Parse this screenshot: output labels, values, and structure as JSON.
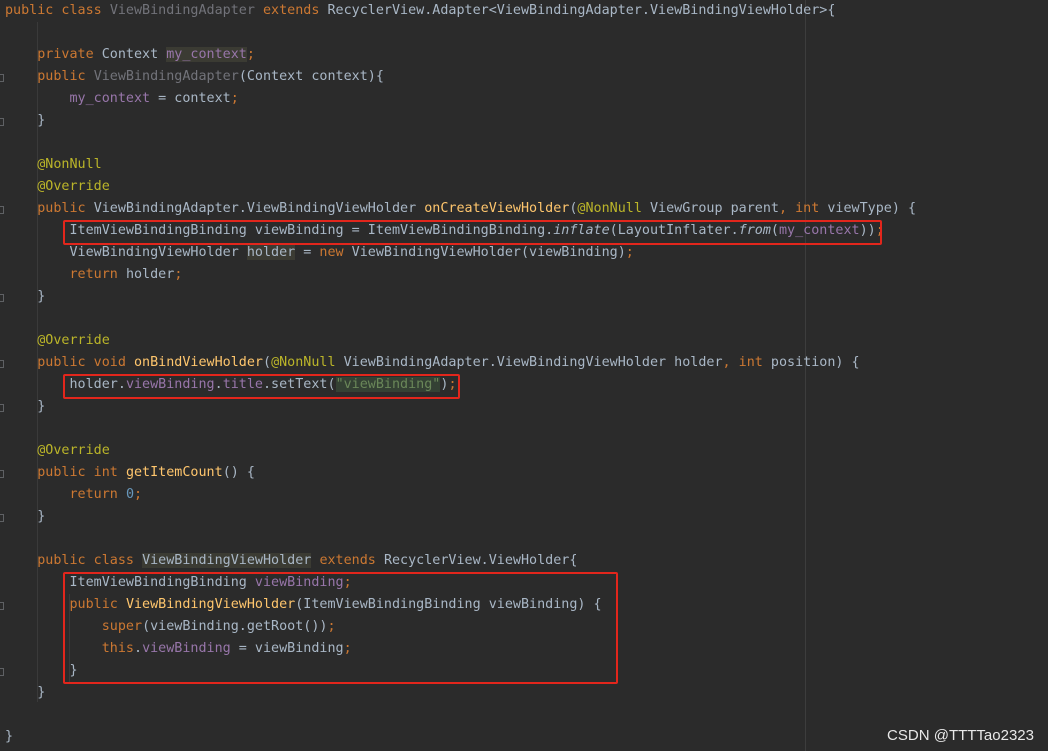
{
  "editor": {
    "language": "java",
    "lines": [
      {
        "id": "l1",
        "tokens": [
          [
            "public class ",
            "kw"
          ],
          [
            "ViewBindingAdapter ",
            "dim"
          ],
          [
            "extends ",
            "kw"
          ],
          [
            "RecyclerView.Adapter<ViewBindingAdapter.ViewBindingViewHolder>{",
            ""
          ]
        ]
      },
      {
        "id": "l2",
        "tokens": []
      },
      {
        "id": "l3",
        "tokens": [
          [
            "    private ",
            "kw"
          ],
          [
            "Context ",
            ""
          ],
          [
            "my_context",
            "fld hl"
          ],
          [
            ";",
            "kw"
          ]
        ]
      },
      {
        "id": "l4",
        "tokens": [
          [
            "    public ",
            "kw"
          ],
          [
            "ViewBindingAdapter",
            "dim"
          ],
          [
            "(Context context){",
            ""
          ]
        ]
      },
      {
        "id": "l5",
        "tokens": [
          [
            "        ",
            ""
          ],
          [
            "my_context",
            "fld"
          ],
          [
            " = context",
            ""
          ],
          [
            ";",
            "kw"
          ]
        ]
      },
      {
        "id": "l6",
        "tokens": [
          [
            "    }",
            ""
          ]
        ]
      },
      {
        "id": "l7",
        "tokens": []
      },
      {
        "id": "l8",
        "tokens": [
          [
            "    @NonNull",
            "ann"
          ]
        ]
      },
      {
        "id": "l9",
        "tokens": [
          [
            "    @Override",
            "ann"
          ]
        ]
      },
      {
        "id": "l10",
        "tokens": [
          [
            "    public ",
            "kw"
          ],
          [
            "ViewBindingAdapter.ViewBindingViewHolder ",
            ""
          ],
          [
            "onCreateViewHolder",
            "fn"
          ],
          [
            "(",
            ""
          ],
          [
            "@NonNull ",
            "ann"
          ],
          [
            "ViewGroup parent",
            ""
          ],
          [
            ", ",
            "kw"
          ],
          [
            "int ",
            "kw"
          ],
          [
            "viewType) {",
            ""
          ]
        ]
      },
      {
        "id": "l11",
        "tokens": [
          [
            "        ItemViewBindingBinding viewBinding = ItemViewBindingBinding.",
            ""
          ],
          [
            "inflate",
            "it"
          ],
          [
            "(LayoutInflater.",
            ""
          ],
          [
            "from",
            "it"
          ],
          [
            "(",
            ""
          ],
          [
            "my_context",
            "fld"
          ],
          [
            "))",
            ""
          ],
          [
            ";",
            "kw"
          ]
        ]
      },
      {
        "id": "l12",
        "tokens": [
          [
            "        ViewBindingViewHolder ",
            ""
          ],
          [
            "holder",
            "hl"
          ],
          [
            " = ",
            ""
          ],
          [
            "new ",
            "kw"
          ],
          [
            "ViewBindingViewHolder(viewBinding)",
            ""
          ],
          [
            ";",
            "kw"
          ]
        ]
      },
      {
        "id": "l13",
        "tokens": [
          [
            "        ",
            ""
          ],
          [
            "return ",
            "kw"
          ],
          [
            "holder",
            ""
          ],
          [
            ";",
            "kw"
          ]
        ]
      },
      {
        "id": "l14",
        "tokens": [
          [
            "    }",
            ""
          ]
        ]
      },
      {
        "id": "l15",
        "tokens": []
      },
      {
        "id": "l16",
        "tokens": [
          [
            "    @Override",
            "ann"
          ]
        ]
      },
      {
        "id": "l17",
        "tokens": [
          [
            "    public void ",
            "kw"
          ],
          [
            "onBindViewHolder",
            "fn"
          ],
          [
            "(",
            ""
          ],
          [
            "@NonNull ",
            "ann"
          ],
          [
            "ViewBindingAdapter.ViewBindingViewHolder holder",
            ""
          ],
          [
            ", ",
            "kw"
          ],
          [
            "int ",
            "kw"
          ],
          [
            "position) {",
            ""
          ]
        ]
      },
      {
        "id": "l18",
        "tokens": [
          [
            "        holder.",
            ""
          ],
          [
            "viewBinding",
            "fld"
          ],
          [
            ".",
            ""
          ],
          [
            "title",
            "fld"
          ],
          [
            ".setText(",
            ""
          ],
          [
            "\"viewBinding\"",
            "str hl2"
          ],
          [
            ")",
            ""
          ],
          [
            ";",
            "kw"
          ]
        ]
      },
      {
        "id": "l19",
        "tokens": [
          [
            "    }",
            ""
          ]
        ]
      },
      {
        "id": "l20",
        "tokens": []
      },
      {
        "id": "l21",
        "tokens": [
          [
            "    @Override",
            "ann"
          ]
        ]
      },
      {
        "id": "l22",
        "tokens": [
          [
            "    public int ",
            "kw"
          ],
          [
            "getItemCount",
            "fn"
          ],
          [
            "() {",
            ""
          ]
        ]
      },
      {
        "id": "l23",
        "tokens": [
          [
            "        ",
            ""
          ],
          [
            "return ",
            "kw"
          ],
          [
            "0",
            "num"
          ],
          [
            ";",
            "kw"
          ]
        ]
      },
      {
        "id": "l24",
        "tokens": [
          [
            "    }",
            ""
          ]
        ]
      },
      {
        "id": "l25",
        "tokens": []
      },
      {
        "id": "l26",
        "tokens": [
          [
            "    public class ",
            "kw"
          ],
          [
            "ViewBindingViewHolder",
            "hl"
          ],
          [
            " ",
            ""
          ],
          [
            "extends ",
            "kw"
          ],
          [
            "RecyclerView.ViewHolder{",
            ""
          ]
        ]
      },
      {
        "id": "l27",
        "tokens": [
          [
            "        ItemViewBindingBinding ",
            ""
          ],
          [
            "viewBinding",
            "fld"
          ],
          [
            ";",
            "kw"
          ]
        ]
      },
      {
        "id": "l28",
        "tokens": [
          [
            "        ",
            ""
          ],
          [
            "public ",
            "kw"
          ],
          [
            "ViewBindingViewHolder",
            "fn"
          ],
          [
            "(ItemViewBindingBinding viewBinding) {",
            ""
          ]
        ]
      },
      {
        "id": "l29",
        "tokens": [
          [
            "            ",
            ""
          ],
          [
            "super",
            "kw"
          ],
          [
            "(viewBinding.getRoot())",
            ""
          ],
          [
            ";",
            "kw"
          ]
        ]
      },
      {
        "id": "l30",
        "tokens": [
          [
            "            ",
            ""
          ],
          [
            "this",
            "kw"
          ],
          [
            ".",
            ""
          ],
          [
            "viewBinding",
            "fld"
          ],
          [
            " = viewBinding",
            ""
          ],
          [
            ";",
            "kw"
          ]
        ]
      },
      {
        "id": "l31",
        "tokens": [
          [
            "        }",
            ""
          ]
        ]
      },
      {
        "id": "l32",
        "tokens": [
          [
            "    }",
            ""
          ]
        ]
      },
      {
        "id": "l33",
        "tokens": []
      },
      {
        "id": "l34",
        "tokens": [
          [
            "}",
            ""
          ]
        ]
      }
    ]
  },
  "watermark": "CSDN @TTTTao2323",
  "colors": {
    "background": "#2b2b2b",
    "keyword": "#cc7832",
    "method": "#ffc66d",
    "annotation": "#bbb529",
    "field": "#9876aa",
    "number": "#6897bb",
    "string": "#6a8759",
    "highlight_box": "#e2261c"
  }
}
